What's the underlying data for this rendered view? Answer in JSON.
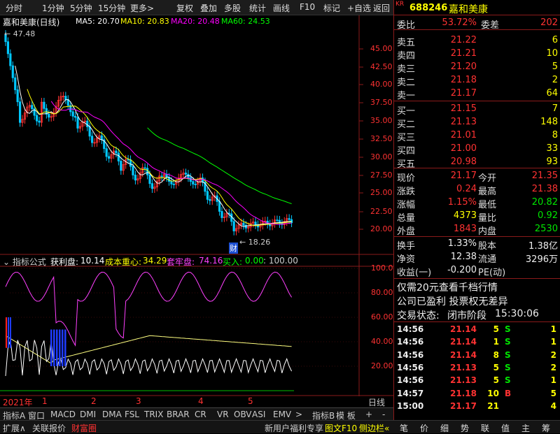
{
  "toolbar": {
    "left_items": [
      "分时",
      "1分钟",
      "5分钟",
      "15分钟",
      "更多>"
    ],
    "right_items": [
      "复权",
      "叠加",
      "多股",
      "统计",
      "画线",
      "F10",
      "标记",
      "+自选",
      "返回"
    ]
  },
  "chart": {
    "title": "嘉和美康(日线)",
    "ma5": "MA5: 20.70",
    "ma10": "MA10: 20.83",
    "ma20": "MA20: 20.48",
    "ma60": "MA60: 24.53",
    "high_marker": "47.48",
    "low_marker": "18.26",
    "cai_badge": "财",
    "price_axis": [
      "45.00",
      "42.50",
      "40.00",
      "37.50",
      "35.00",
      "32.50",
      "30.00",
      "27.50",
      "25.00",
      "22.50",
      "20.00"
    ],
    "colors": {
      "ma5": "#ffffff",
      "ma10": "#ffff00",
      "ma20": "#ff00ff",
      "ma60": "#00ff00",
      "up": "#ff3232",
      "down": "#00c8ff"
    }
  },
  "indicator": {
    "title_prefix": "指标公式",
    "name": "获利盘:",
    "name_val": "10.14",
    "cost_lbl": "成本重心:",
    "cost_val": "34.29",
    "trap_lbl": "套牢盘:",
    "trap_val": "74.16",
    "buy_lbl": "买入:",
    "buy_val": "0.00",
    "max_val": ": 100.00",
    "axis": [
      "100.0",
      "80.00",
      "60.00",
      "40.00",
      "20.00"
    ]
  },
  "time_axis": {
    "year": "2021年",
    "months": [
      "1",
      "2",
      "3",
      "4",
      "5"
    ],
    "period": "日线"
  },
  "indicator_tabs": [
    "指标A",
    "窗口",
    "MACD",
    "DMI",
    "DMA",
    "FSL",
    "TRIX",
    "BRAR",
    "CR",
    "VR",
    "OBV",
    "ASI",
    "EMV",
    ">",
    "指标B",
    "模 板",
    "+",
    "-"
  ],
  "bottom_bar": {
    "left": [
      "扩展∧",
      "关联报价",
      "财富圈"
    ],
    "promo": "新用户福利专享",
    "f10": "图文F10",
    "side": "侧边栏«",
    "right_tabs": [
      "笔",
      "价",
      "细",
      "势",
      "联",
      "值",
      "主",
      "筹"
    ]
  },
  "quote": {
    "kr": "KR",
    "code": "688246",
    "name": "嘉和美康",
    "weibi_lbl": "委比",
    "weibi_val": "53.72%",
    "weicha_lbl": "委差",
    "weicha_val": "202",
    "asks": [
      {
        "label": "卖五",
        "price": "21.22",
        "vol": "6"
      },
      {
        "label": "卖四",
        "price": "21.21",
        "vol": "10"
      },
      {
        "label": "卖三",
        "price": "21.20",
        "vol": "5"
      },
      {
        "label": "卖二",
        "price": "21.18",
        "vol": "2"
      },
      {
        "label": "卖一",
        "price": "21.17",
        "vol": "64"
      }
    ],
    "bids": [
      {
        "label": "买一",
        "price": "21.15",
        "vol": "7"
      },
      {
        "label": "买二",
        "price": "21.13",
        "vol": "148"
      },
      {
        "label": "买三",
        "price": "21.01",
        "vol": "8"
      },
      {
        "label": "买四",
        "price": "21.00",
        "vol": "33"
      },
      {
        "label": "买五",
        "price": "20.98",
        "vol": "93"
      }
    ],
    "stats": [
      {
        "l1": "现价",
        "v1": "21.17",
        "c1": "red",
        "l2": "今开",
        "v2": "21.35",
        "c2": "red"
      },
      {
        "l1": "涨跌",
        "v1": "0.24",
        "c1": "red",
        "l2": "最高",
        "v2": "21.38",
        "c2": "red"
      },
      {
        "l1": "涨幅",
        "v1": "1.15%",
        "c1": "red",
        "l2": "最低",
        "v2": "20.82",
        "c2": "green"
      },
      {
        "l1": "总量",
        "v1": "4373",
        "c1": "yellow",
        "l2": "量比",
        "v2": "0.92",
        "c2": "green"
      },
      {
        "l1": "外盘",
        "v1": "1843",
        "c1": "red",
        "l2": "内盘",
        "v2": "2530",
        "c2": "green"
      }
    ],
    "stats2": [
      {
        "l1": "换手",
        "v1": "1.33%",
        "l2": "股本",
        "v2": "1.38亿"
      },
      {
        "l1": "净资",
        "v1": "12.38",
        "l2": "流通",
        "v2": "3296万"
      },
      {
        "l1": "收益(一)",
        "v1": "-0.200",
        "l2": "PE(动)",
        "v2": ""
      }
    ],
    "promo1": "仅需20元查看千档行情",
    "promo2": "公司已盈利 投票权无差异",
    "status_lbl": "交易状态:",
    "status_val": "闭市阶段",
    "status_time": "15:30:06",
    "ticks": [
      {
        "t": "14:56",
        "p": "21.14",
        "v": "5",
        "s": "S",
        "n": "1"
      },
      {
        "t": "14:56",
        "p": "21.14",
        "v": "1",
        "s": "S",
        "n": "1"
      },
      {
        "t": "14:56",
        "p": "21.14",
        "v": "8",
        "s": "S",
        "n": "2"
      },
      {
        "t": "14:56",
        "p": "21.13",
        "v": "5",
        "s": "S",
        "n": "2"
      },
      {
        "t": "14:56",
        "p": "21.13",
        "v": "5",
        "s": "S",
        "n": "1"
      },
      {
        "t": "14:57",
        "p": "21.18",
        "v": "10",
        "s": "B",
        "n": "5"
      },
      {
        "t": "15:00",
        "p": "21.17",
        "v": "21",
        "s": "",
        "n": "4"
      }
    ]
  }
}
